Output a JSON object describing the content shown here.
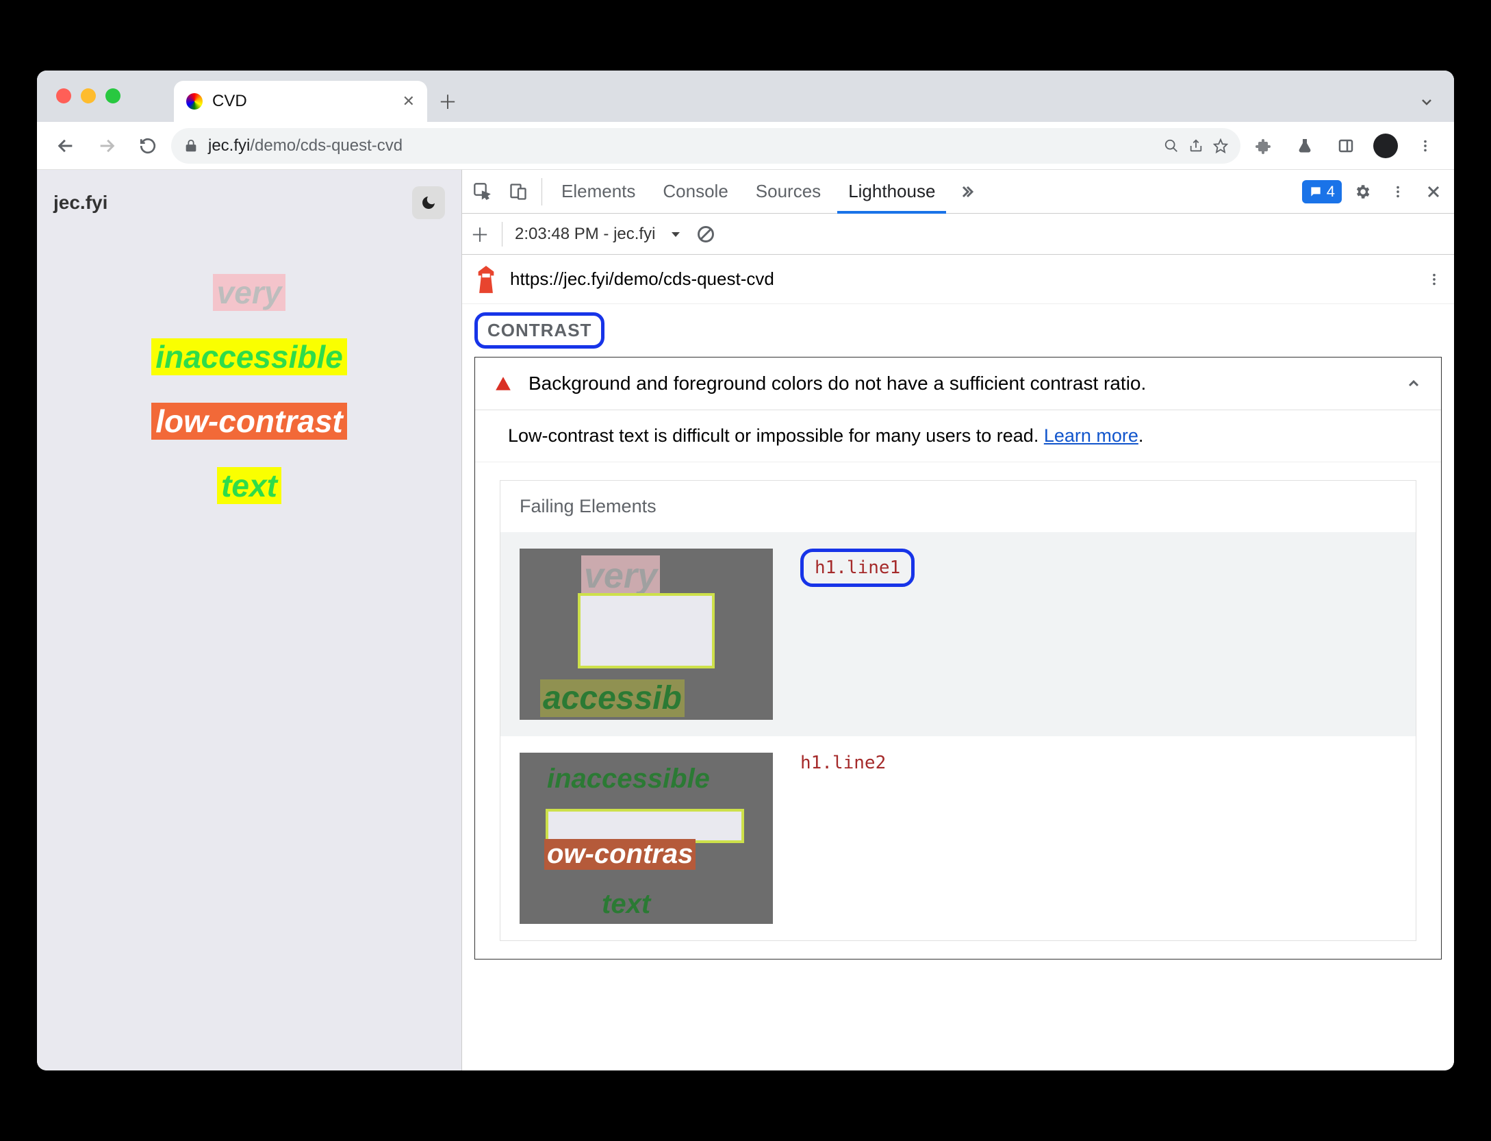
{
  "browser": {
    "tab_title": "CVD",
    "url_host": "jec.fyi",
    "url_path": "/demo/cds-quest-cvd"
  },
  "page": {
    "site_name": "jec.fyi",
    "samples": [
      "very",
      "inaccessible",
      "low-contrast",
      "text"
    ]
  },
  "devtools": {
    "tabs": [
      "Elements",
      "Console",
      "Sources",
      "Lighthouse"
    ],
    "active_tab": "Lighthouse",
    "issue_count": "4",
    "lighthouse_toolbar": {
      "run_label": "2:03:48 PM - jec.fyi"
    },
    "report_url": "https://jec.fyi/demo/cds-quest-cvd",
    "section": "CONTRAST",
    "audit": {
      "title": "Background and foreground colors do not have a sufficient contrast ratio.",
      "description": "Low-contrast text is difficult or impossible for many users to read. ",
      "learn_more": "Learn more",
      "description_tail": ".",
      "failing_title": "Failing Elements",
      "failing": [
        {
          "selector": "h1.line1",
          "highlighted": true
        },
        {
          "selector": "h1.line2",
          "highlighted": false
        }
      ]
    }
  }
}
